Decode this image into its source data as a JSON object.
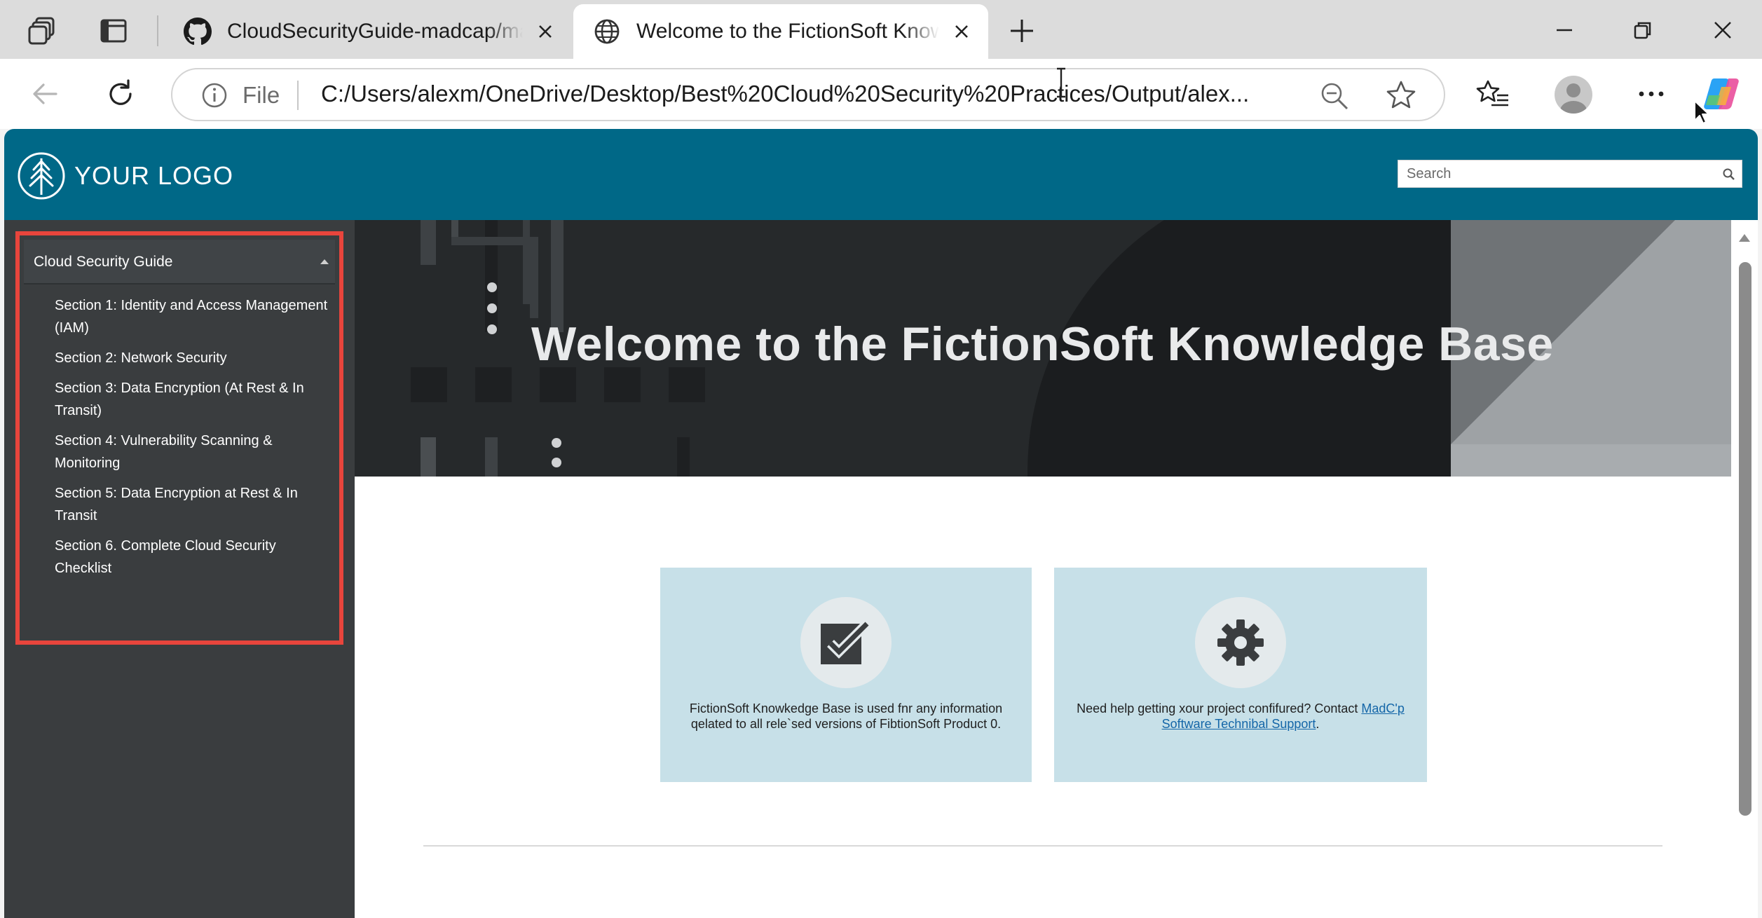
{
  "browser": {
    "tabs": [
      {
        "title": "CloudSecurityGuide-madcap/madcap",
        "favicon": "github-icon",
        "active": false
      },
      {
        "title": "Welcome to the FictionSoft Knowledge Base",
        "favicon": "globe-icon",
        "active": true
      }
    ],
    "address_bar": {
      "scheme_label": "File",
      "url": "C:/Users/alexm/OneDrive/Desktop/Best%20Cloud%20Security%20Practices/Output/alex..."
    }
  },
  "site": {
    "logo_text": "YOUR LOGO",
    "search_placeholder": "Search",
    "header_color": "#006887"
  },
  "sidebar": {
    "title": "Cloud Security Guide",
    "items": [
      {
        "label": "Section 1: Identity and Access Management (IAM)"
      },
      {
        "label": "Section 2: Network Security"
      },
      {
        "label": "Section 3: Data Encryption (At Rest & In Transit)"
      },
      {
        "label": "Section 4: Vulnerability Scanning & Monitoring"
      },
      {
        "label": "Section 5: Data Encryption at Rest & In Transit"
      },
      {
        "label": "Section 6. Complete Cloud Security Checklist"
      }
    ],
    "highlight_color": "#e8453c"
  },
  "hero": {
    "title": "Welcome to the FictionSoft Knowledge Base"
  },
  "cards": [
    {
      "icon": "checkbox-icon",
      "text": "FictionSoft Knowkedge Base is used fnr any information qelated to all rele`sed versions of FibtionSoft Product 0."
    },
    {
      "icon": "gear-icon",
      "text_before": "Need help getting xour project confifured? Contact ",
      "link_text": "MadC'p Software Technibal Support",
      "text_after": "."
    }
  ]
}
